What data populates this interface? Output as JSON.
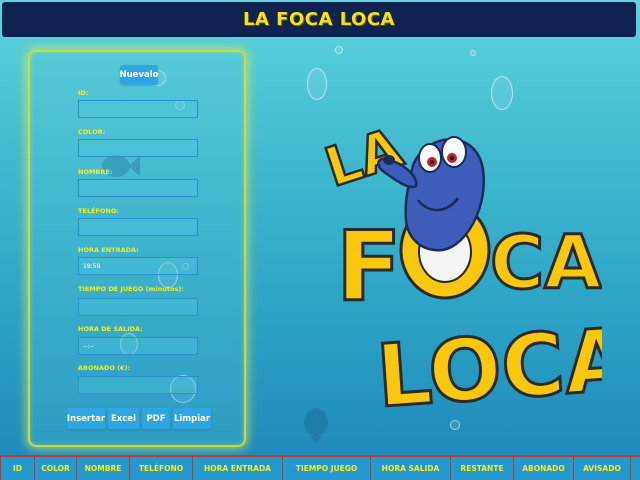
{
  "header": {
    "title": "LA FOCA LOCA"
  },
  "logo": {
    "line1": "LA",
    "line2a": "F",
    "line2b": "CA",
    "line3": "LOCA",
    "text_color": "#f9c80e",
    "outline_color": "#2a2a2a",
    "seal_color": "#3e5db8"
  },
  "form": {
    "new_button": "Nuevalo",
    "fields": [
      {
        "label": "ID:",
        "value": "",
        "placeholder": ""
      },
      {
        "label": "COLOR:",
        "value": "",
        "placeholder": ""
      },
      {
        "label": "NOMBRE:",
        "value": "",
        "placeholder": ""
      },
      {
        "label": "TELÉFONO:",
        "value": "",
        "placeholder": ""
      },
      {
        "label": "HORA ENTRADA:",
        "value": "19:59",
        "placeholder": ""
      },
      {
        "label": "TIEMPO DE JUEGO (minutos):",
        "value": "",
        "placeholder": ""
      },
      {
        "label": "HORA DE SALIDA:",
        "value": "--:--",
        "placeholder": ""
      },
      {
        "label": "ABONADO (€):",
        "value": "",
        "placeholder": ""
      }
    ],
    "buttons": {
      "insert": "Insertar",
      "excel": "Excel",
      "pdf": "PDF",
      "clear": "Limpiar"
    }
  },
  "table": {
    "columns": [
      "ID",
      "COLOR",
      "NOMBRE",
      "TELÉFONO",
      "HORA ENTRADA",
      "TIEMPO JUEGO",
      "HORA SALIDA",
      "RESTANTE",
      "ABONADO",
      "AVISADO"
    ]
  },
  "colors": {
    "header_bg": "#0f2250",
    "title_yellow": "#f7e21a",
    "button_blue": "#2fa6e2",
    "panel_glow": "#c7dd3c",
    "table_border": "#c0392b"
  }
}
